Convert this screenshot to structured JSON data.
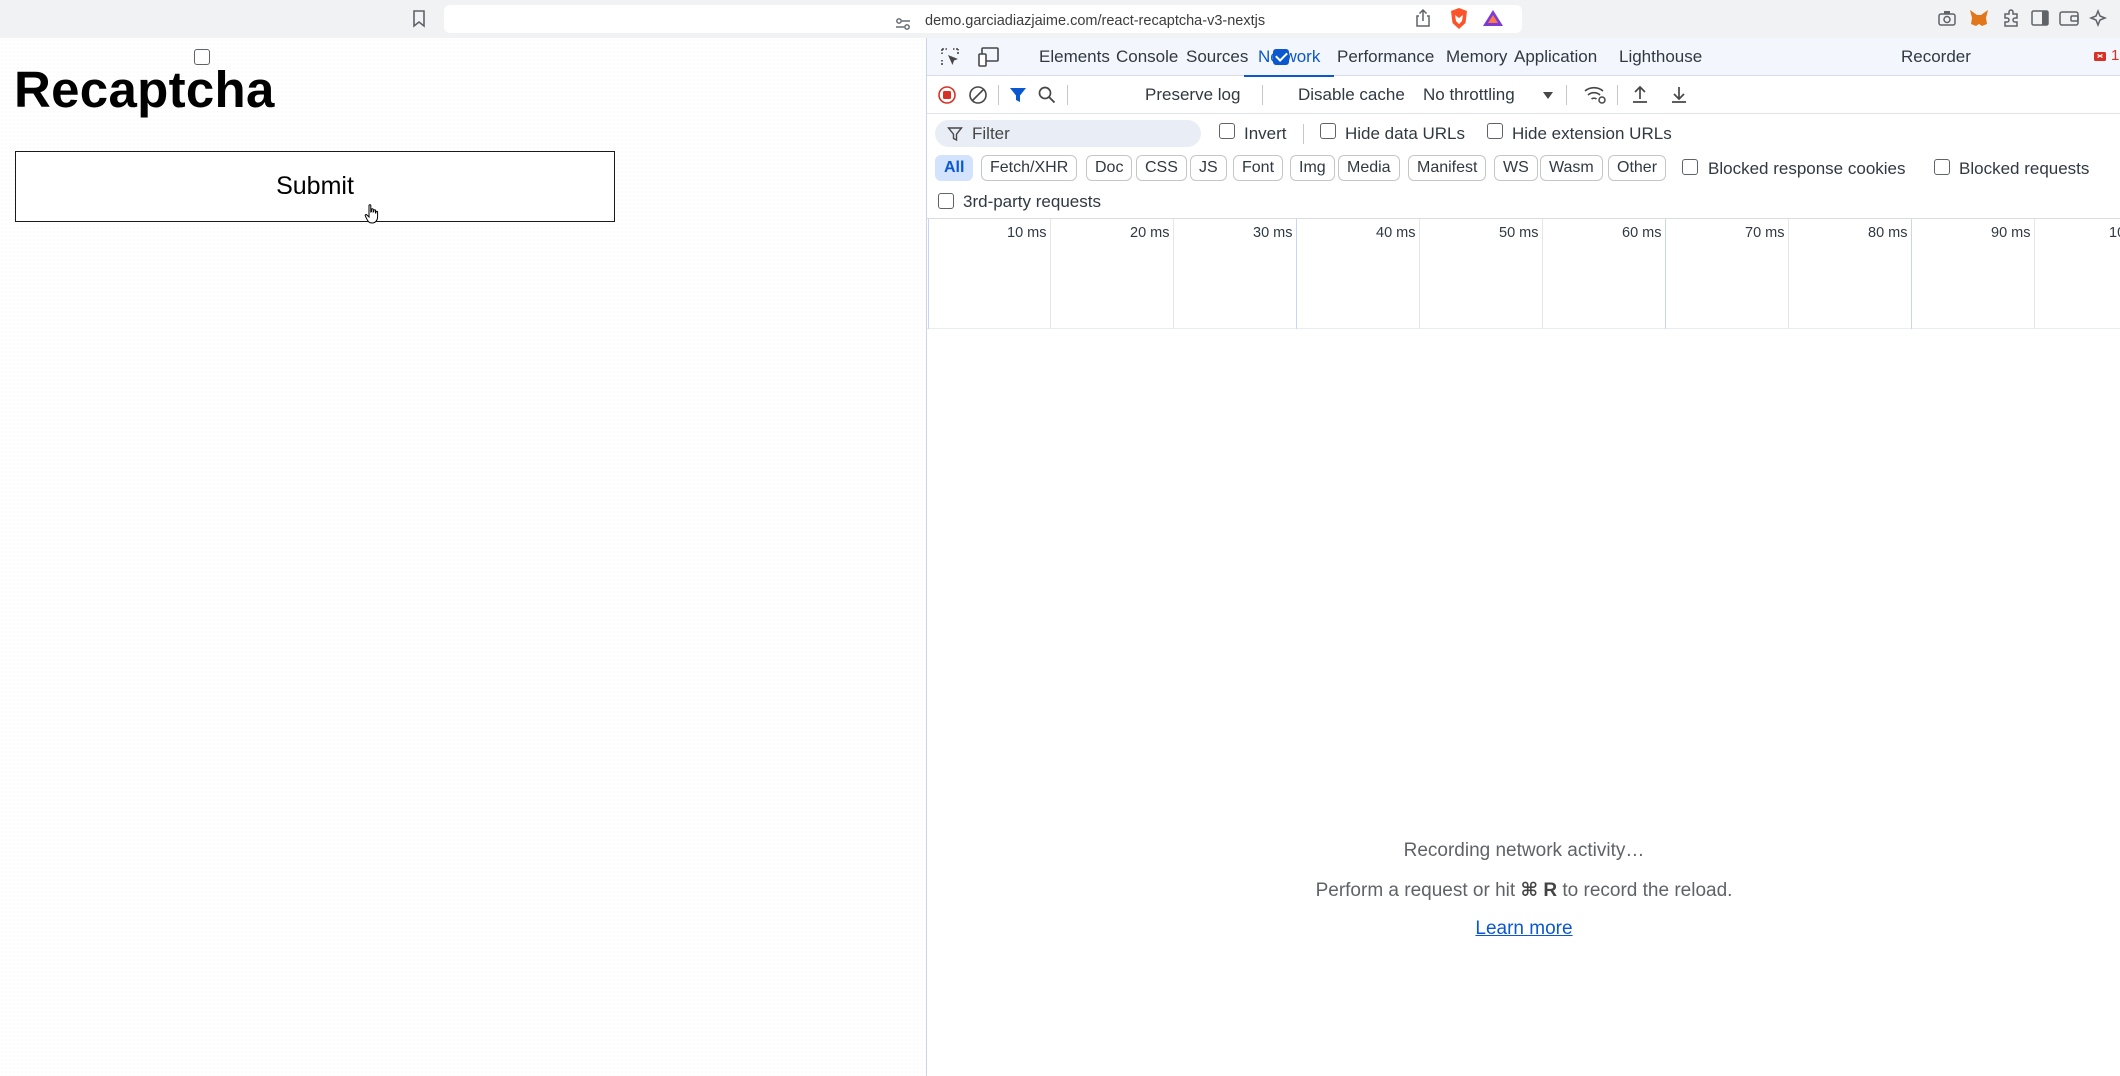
{
  "browser": {
    "url": "demo.garciadiazjaime.com/react-recaptcha-v3-nextjs"
  },
  "page": {
    "title": "Recaptcha",
    "submit_label": "Submit"
  },
  "devtools": {
    "tabs": [
      {
        "label": "Elements"
      },
      {
        "label": "Console"
      },
      {
        "label": "Sources"
      },
      {
        "label": "Network",
        "active": true
      },
      {
        "label": "Performance"
      },
      {
        "label": "Memory"
      },
      {
        "label": "Application"
      },
      {
        "label": "Lighthouse"
      },
      {
        "label": "Recorder"
      }
    ],
    "issues_count": "1",
    "toolbar": {
      "preserve_log": "Preserve log",
      "preserve_log_checked": false,
      "disable_cache": "Disable cache",
      "disable_cache_checked": true,
      "throttling": "No throttling"
    },
    "filter": {
      "placeholder": "Filter",
      "invert": "Invert",
      "hide_data_urls": "Hide data URLs",
      "hide_extension_urls": "Hide extension URLs"
    },
    "types": [
      "All",
      "Fetch/XHR",
      "Doc",
      "CSS",
      "JS",
      "Font",
      "Img",
      "Media",
      "Manifest",
      "WS",
      "Wasm",
      "Other"
    ],
    "active_type": "All",
    "blocked_response_cookies": "Blocked response cookies",
    "blocked_requests": "Blocked requests",
    "third_party": "3rd-party requests",
    "timeline_ticks": [
      "10 ms",
      "20 ms",
      "30 ms",
      "40 ms",
      "50 ms",
      "60 ms",
      "70 ms",
      "80 ms",
      "90 ms",
      "10"
    ],
    "empty": {
      "line1": "Recording network activity…",
      "line2_pre": "Perform a request or hit ",
      "line2_key": "⌘ R",
      "line2_post": " to record the reload.",
      "learn_more": "Learn more"
    },
    "colors": {
      "accent": "#0b57d0",
      "record": "#d93025"
    }
  }
}
